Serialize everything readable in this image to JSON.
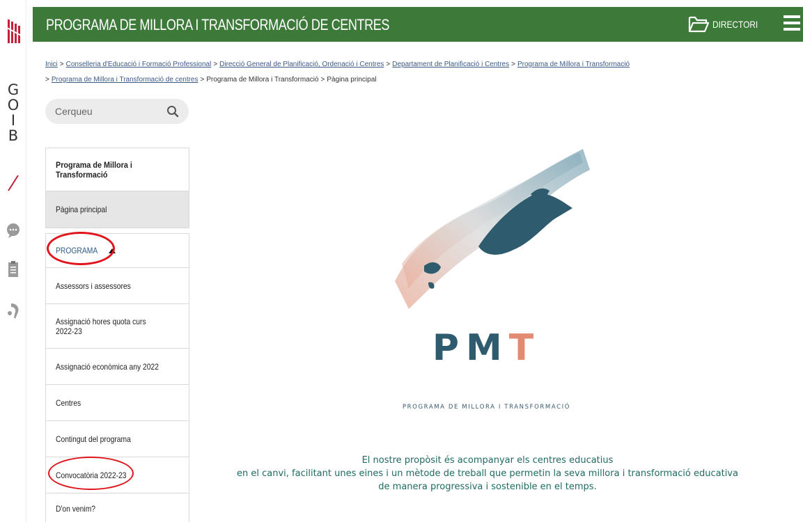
{
  "colors": {
    "header_bg": "#3d7a3a",
    "link": "#3c5a86",
    "section": "#2e5b8a",
    "purpose_text": "#1f6b63",
    "annotation": "#e0141b",
    "pmt_dark": "#2f5b6f",
    "pmt_accent": "#e38a72"
  },
  "rail": {
    "letters": [
      "G",
      "O",
      "I",
      "B"
    ],
    "icons": [
      "chat-icon",
      "clipboard-icon",
      "accessibility-icon"
    ]
  },
  "header": {
    "title": "PROGRAMA DE MILLORA I TRANSFORMACIÓ DE CENTRES",
    "directory_label": "DIRECTORI",
    "directory_icon": "folder-icon",
    "menu_icon": "hamburger-icon"
  },
  "breadcrumb": {
    "links": [
      "Inici",
      "Conselleria d'Educació i Formació Professional",
      "Direcció General de Planificació, Ordenació i Centres",
      "Departament de Planificació i Centres",
      "Programa de Millora i Transformació",
      "Programa de Millora i Transformació de centres"
    ],
    "plain": [
      "Programa de Millora i Transformació",
      "Pàgina principal"
    ],
    "separator": ">"
  },
  "search": {
    "placeholder": "Cerqueu",
    "icon": "search-icon"
  },
  "nav": {
    "title": "Programa de Millora i Transformació",
    "active": "Pàgina principal",
    "section": "PROGRAMA",
    "items": [
      "Assessors i assessores",
      "Assignació hores quota curs 2022-23",
      "Assignació econòmica any 2022",
      "Centres",
      "Contingut del programa",
      "Convocatòria 2022-23",
      "D'on venim?"
    ]
  },
  "logo": {
    "letters": [
      "P",
      "M",
      "T"
    ],
    "subtitle": "PROGRAMA DE MILLORA I TRANSFORMACIÓ"
  },
  "purpose": {
    "line1": "El nostre propòsit és acompanyar els centres educatius",
    "line2": "en el canvi, facilitant unes eines i un mètode de treball que permetin la seva millora i transformació educativa",
    "line3": "de manera progressiva i sostenible en el temps."
  }
}
